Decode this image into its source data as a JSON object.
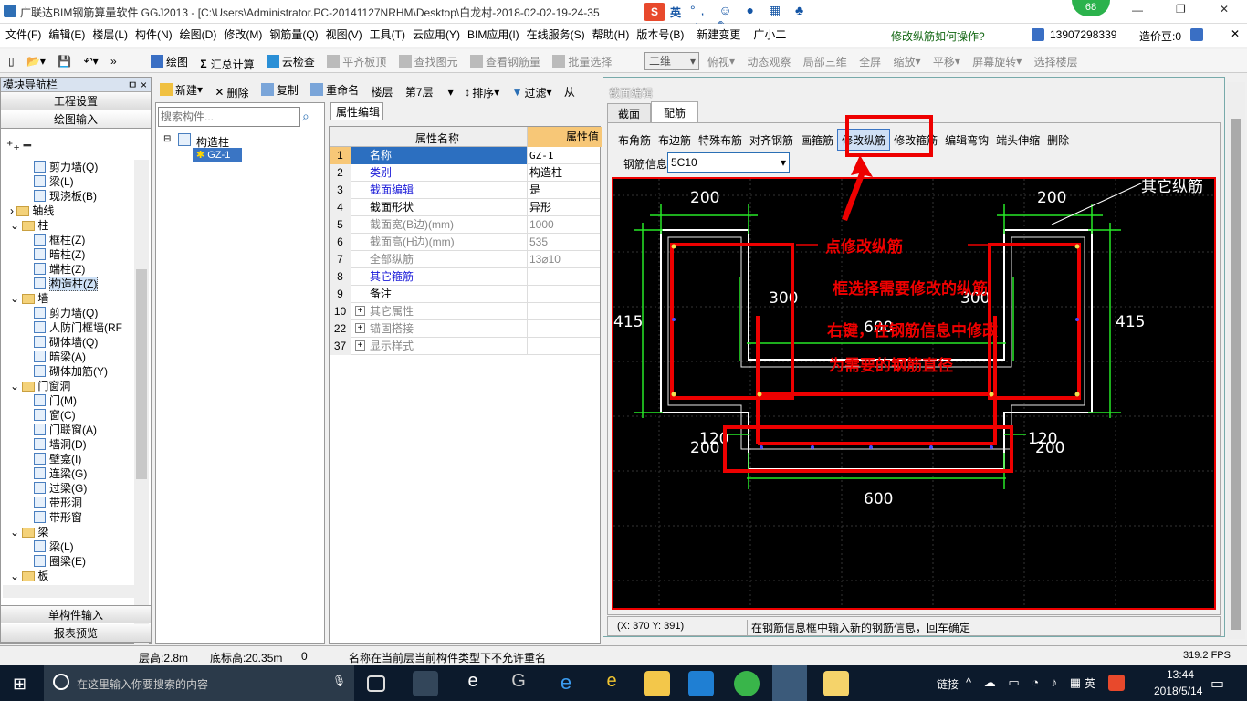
{
  "window": {
    "title": "广联达BIM钢筋算量软件 GGJ2013 - [C:\\Users\\Administrator.PC-20141127NRHM\\Desktop\\白龙村-2018-02-02-19-24-35",
    "badge": "68",
    "ime_label": "英"
  },
  "menu": {
    "items": [
      "文件(F)",
      "编辑(E)",
      "楼层(L)",
      "构件(N)",
      "绘图(D)",
      "修改(M)",
      "钢筋量(Q)",
      "视图(V)",
      "工具(T)",
      "云应用(Y)",
      "BIM应用(I)",
      "在线服务(S)",
      "帮助(H)",
      "版本号(B)",
      "新建变更",
      "广小二"
    ],
    "help_link": "修改纵筋如何操作?",
    "phone": "13907298339",
    "cost_label": "造价豆:0"
  },
  "toolbar": {
    "items": [
      "绘图",
      "汇总计算",
      "云检查",
      "平齐板顶",
      "查找图元",
      "查看钢筋量",
      "批量选择"
    ],
    "view_mode": "二维",
    "view_items": [
      "俯视",
      "动态观察",
      "局部三维",
      "全屏",
      "缩放",
      "平移",
      "屏幕旋转",
      "选择楼层"
    ]
  },
  "nav": {
    "header": "模块导航栏",
    "pin": "ㅁ ×",
    "btn_engineering": "工程设置",
    "btn_draw": "绘图输入",
    "btn_single": "单构件输入",
    "btn_report": "报表预览",
    "tree": [
      "剪力墙(Q)",
      "梁(L)",
      "现浇板(B)",
      "轴线",
      "柱",
      "框柱(Z)",
      "暗柱(Z)",
      "端柱(Z)",
      "构造柱(Z)",
      "墙",
      "剪力墙(Q)",
      "人防门框墙(RF",
      "砌体墙(Q)",
      "暗梁(A)",
      "砌体加筋(Y)",
      "门窗洞",
      "门(M)",
      "窗(C)",
      "门联窗(A)",
      "墙洞(D)",
      "壁龛(I)",
      "连梁(G)",
      "过梁(G)",
      "带形洞",
      "带形窗",
      "梁",
      "梁(L)",
      "圈梁(E)",
      "板"
    ]
  },
  "component_toolbar": {
    "new": "新建",
    "delete": "删除",
    "copy": "复制",
    "rename": "重命名",
    "floor_label": "楼层",
    "floor_value": "第7层",
    "sort": "排序",
    "filter": "过滤",
    "from": "从"
  },
  "component_list": {
    "search_placeholder": "搜索构件...",
    "group": "构造柱",
    "item": "GZ-1"
  },
  "props": {
    "tab": "属性编辑",
    "col_name": "属性名称",
    "col_value": "属性值",
    "rows": [
      {
        "no": "1",
        "name": "名称",
        "value": "GZ-1"
      },
      {
        "no": "2",
        "name": "类别",
        "value": "构造柱"
      },
      {
        "no": "3",
        "name": "截面编辑",
        "value": "是"
      },
      {
        "no": "4",
        "name": "截面形状",
        "value": "异形"
      },
      {
        "no": "5",
        "name": "截面宽(B边)(mm)",
        "value": "1000"
      },
      {
        "no": "6",
        "name": "截面高(H边)(mm)",
        "value": "535"
      },
      {
        "no": "7",
        "name": "全部纵筋",
        "value": "13⌀10"
      },
      {
        "no": "8",
        "name": "其它箍筋",
        "value": ""
      },
      {
        "no": "9",
        "name": "备注",
        "value": ""
      },
      {
        "no": "10",
        "name": "其它属性",
        "value": ""
      },
      {
        "no": "22",
        "name": "锚固搭接",
        "value": ""
      },
      {
        "no": "37",
        "name": "显示样式",
        "value": ""
      }
    ]
  },
  "section_editor": {
    "title": "截面编辑",
    "tab_section": "截面",
    "tab_rebar": "配筋",
    "tools": [
      "布角筋",
      "布边筋",
      "特殊布筋",
      "对齐钢筋",
      "画箍筋",
      "修改纵筋",
      "修改箍筋",
      "编辑弯钩",
      "端头伸缩",
      "删除"
    ],
    "rebar_info_label": "钢筋信息",
    "rebar_info_value": "5C10",
    "coords": "(X: 370 Y: 391)",
    "hint": "在钢筋信息框中输入新的钢筋信息，回车确定",
    "dims": {
      "d200a": "200",
      "d200b": "200",
      "d415a": "415",
      "d415b": "415",
      "d300a": "300",
      "d300b": "300",
      "d600": "600",
      "d120a": "120",
      "d120b": "120",
      "d200c": "200",
      "d200d": "200",
      "d600b": "600",
      "other": "其它纵筋"
    },
    "notes": [
      "点修改纵筋",
      "框选择需要修改的纵筋",
      "右键，在钢筋信息中修改",
      "为需要的钢筋直径"
    ]
  },
  "status": {
    "floor_h": "层高:2.8m",
    "base_h": "底标高:20.35m",
    "zero": "0",
    "msg": "名称在当前层当前构件类型下不允许重名",
    "fps": "319.2 FPS"
  },
  "taskbar": {
    "search": "在这里输入你要搜索的内容",
    "link": "链接",
    "ime": "英",
    "time": "13:44",
    "date": "2018/5/14"
  }
}
